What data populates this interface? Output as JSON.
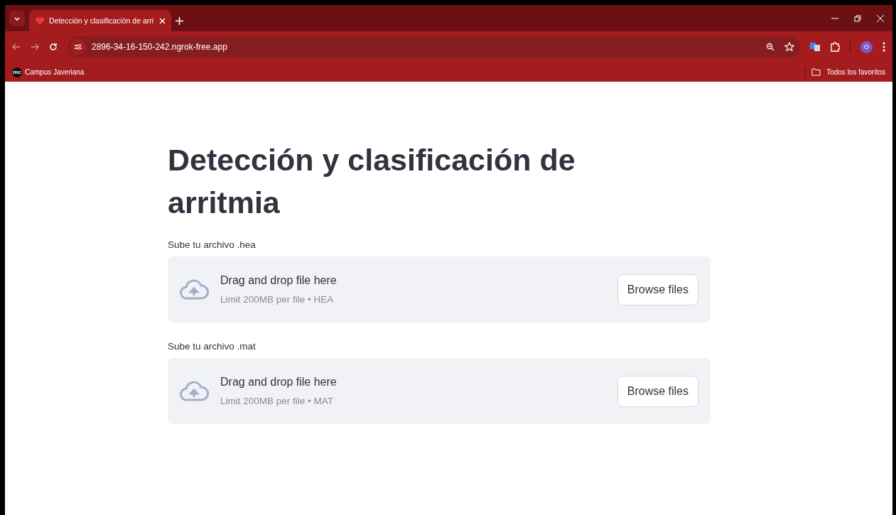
{
  "browser": {
    "tab": {
      "title": "Detección y clasificación de arri",
      "selected": true
    },
    "address": "2896-34-16-150-242.ngrok-free.app",
    "profile": "O",
    "bookmarks": [
      {
        "label": "Campus Javeriana",
        "icon": "mc"
      }
    ],
    "all_bookmarks": "Todos los favoritos"
  },
  "page": {
    "title": "Detección y clasificación de arritmia",
    "uploaders": [
      {
        "label": "Sube tu archivo .hea",
        "instruction": "Drag and drop file here",
        "limit": "Limit 200MB per file • HEA",
        "button": "Browse files"
      },
      {
        "label": "Sube tu archivo .mat",
        "instruction": "Drag and drop file here",
        "limit": "Limit 200MB per file • MAT",
        "button": "Browse files"
      }
    ]
  }
}
